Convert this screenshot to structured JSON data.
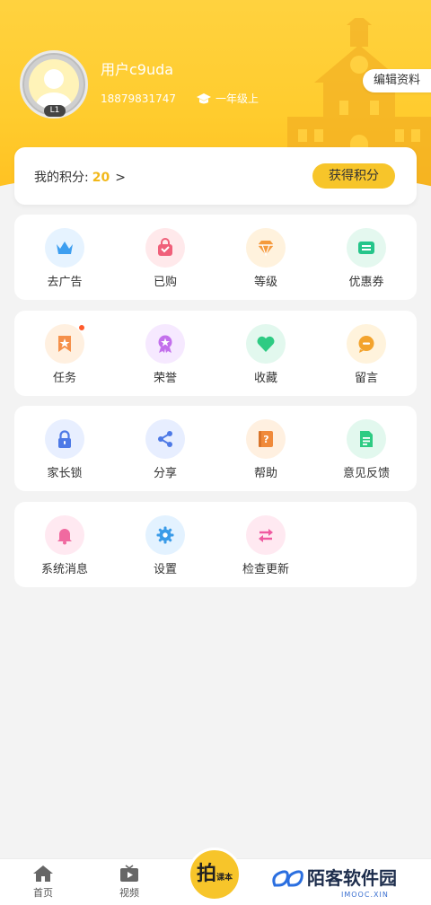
{
  "profile": {
    "username": "用户c9uda",
    "phone": "18879831747",
    "grade": "一年级上",
    "level_badge": "L1",
    "edit_label": "编辑资料"
  },
  "points": {
    "label": "我的积分:",
    "value": "20",
    "arrow": ">",
    "earn_label": "获得积分"
  },
  "sections": [
    {
      "items": [
        {
          "label": "去广告",
          "icon": "crown-icon",
          "bg": "#e6f3ff",
          "color": "#3d9ef0"
        },
        {
          "label": "已购",
          "icon": "bag-icon",
          "bg": "#ffe9eb",
          "color": "#f0607a"
        },
        {
          "label": "等级",
          "icon": "diamond-icon",
          "bg": "#fff2dd",
          "color": "#f59a3c"
        },
        {
          "label": "优惠券",
          "icon": "coupon-icon",
          "bg": "#e4f8ef",
          "color": "#25c58a"
        }
      ]
    },
    {
      "items": [
        {
          "label": "任务",
          "icon": "task-icon",
          "bg": "#fff0e0",
          "color": "#f5904a",
          "dot": true
        },
        {
          "label": "荣誉",
          "icon": "medal-icon",
          "bg": "#f6e9ff",
          "color": "#c370ec"
        },
        {
          "label": "收藏",
          "icon": "heart-icon",
          "bg": "#e2f8ee",
          "color": "#2ecb83"
        },
        {
          "label": "留言",
          "icon": "message-icon",
          "bg": "#fff3dc",
          "color": "#f3a32c"
        }
      ]
    },
    {
      "items": [
        {
          "label": "家长锁",
          "icon": "lock-icon",
          "bg": "#e8efff",
          "color": "#4d79e6"
        },
        {
          "label": "分享",
          "icon": "share-icon",
          "bg": "#e7eeff",
          "color": "#4d79e6"
        },
        {
          "label": "帮助",
          "icon": "help-icon",
          "bg": "#fff0e0",
          "color": "#f08a3a"
        },
        {
          "label": "意见反馈",
          "icon": "feedback-icon",
          "bg": "#e2f8ee",
          "color": "#2ecb83"
        }
      ]
    },
    {
      "items": [
        {
          "label": "系统消息",
          "icon": "bell-icon",
          "bg": "#ffe9f1",
          "color": "#f06aa0"
        },
        {
          "label": "设置",
          "icon": "gear-icon",
          "bg": "#e3f2ff",
          "color": "#3a9be8"
        },
        {
          "label": "检查更新",
          "icon": "refresh-icon",
          "bg": "#ffe9f1",
          "color": "#ef5aa0"
        }
      ]
    }
  ],
  "tabbar": {
    "home": "首页",
    "video": "视频",
    "center_big": "拍",
    "center_small": "课本"
  },
  "watermark": {
    "text": "陌客软件园",
    "sub": "IMOOC.XIN"
  }
}
